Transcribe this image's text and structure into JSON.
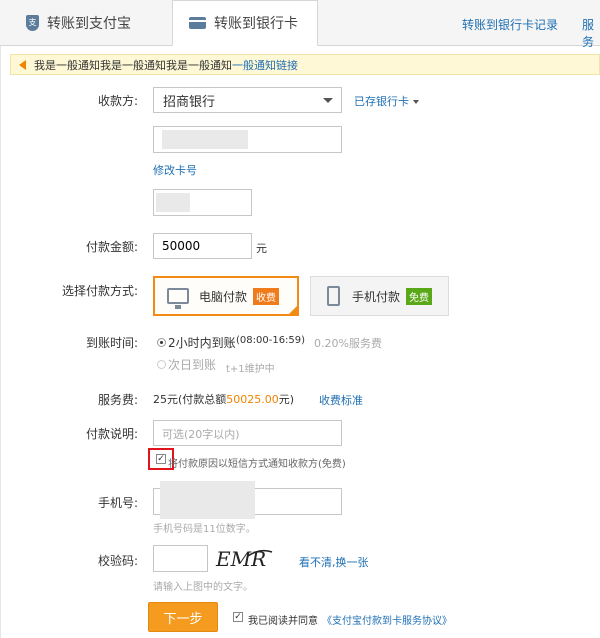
{
  "tabs": {
    "alipay": "转账到支付宝",
    "bank": "转账到银行卡",
    "alipay_icon_text": "支"
  },
  "top_links": {
    "records": "转账到银行卡记录",
    "service": "服务"
  },
  "notice": {
    "text": "我是一般通知我是一般通知我是一般通知",
    "link": "一般通知链接"
  },
  "form": {
    "payee_label": "收款方:",
    "bank_selected": "招商银行",
    "saved_cards": "已存银行卡",
    "modify_card": "修改卡号",
    "amount_label": "付款金额:",
    "amount_value": "50000",
    "amount_unit": "元",
    "method_label": "选择付款方式:",
    "pc_pay": "电脑付款",
    "pc_badge": "收费",
    "mobile_pay": "手机付款",
    "mobile_badge": "免费",
    "arrival_label": "到账时间:",
    "arrival_fast": "2小时内到账",
    "arrival_fast_time": "(08:00-16:59)",
    "arrival_fast_fee": "0.20%服务费",
    "arrival_next": "次日到账",
    "arrival_next_note": "t+1维护中",
    "fee_label": "服务费:",
    "fee_text_pre": "25元(付款总额",
    "fee_total": "50025.00",
    "fee_text_post": "元)",
    "fee_standard": "收费标准",
    "note_label": "付款说明:",
    "note_placeholder": "可选(20字以内)",
    "sms_text": "将付款原因以短信方式通知收款方(免费)",
    "phone_label": "手机号:",
    "phone_hint": "手机号码是11位数字。",
    "captcha_label": "校验码:",
    "captcha_text": "EMR",
    "captcha_refresh": "看不清,换一张",
    "captcha_hint": "请输入上图中的文字。",
    "next_button": "下一步",
    "agree_pre": "我已阅读并同意",
    "agree_link": "《支付宝付款到卡服务协议》"
  },
  "colors": {
    "link": "#1f6fb3",
    "accent": "#f28a14",
    "highlight_box": "#e0141a"
  }
}
